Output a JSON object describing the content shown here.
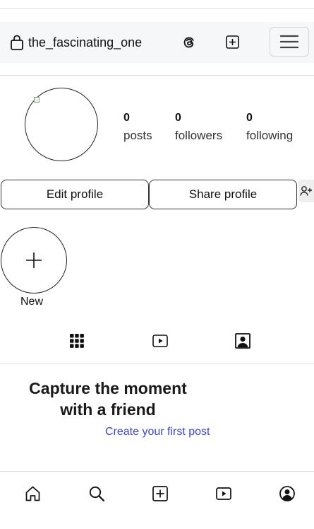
{
  "header": {
    "username": "the_fascinating_one",
    "icons": [
      "lock-icon",
      "threads-icon",
      "new-post-icon",
      "hamburger-menu-icon"
    ]
  },
  "profile": {
    "stats": [
      {
        "value": "0",
        "label": "posts"
      },
      {
        "value": "0",
        "label": "followers"
      },
      {
        "value": "0",
        "label": "following"
      }
    ],
    "edit_label": "Edit profile",
    "share_label": "Share profile"
  },
  "highlights": {
    "new_label": "New"
  },
  "tabs": [
    "grid-icon",
    "reels-icon",
    "tagged-icon"
  ],
  "empty_state": {
    "title_line1": "Capture the moment",
    "title_line2": "with a friend",
    "link": "Create your first post"
  },
  "bottom_nav": [
    "home-icon",
    "search-icon",
    "create-icon",
    "reels-icon",
    "profile-icon"
  ],
  "colors": {
    "link": "#3b47c9",
    "header_bg": "#f6f7f8",
    "divider": "#dedede"
  }
}
